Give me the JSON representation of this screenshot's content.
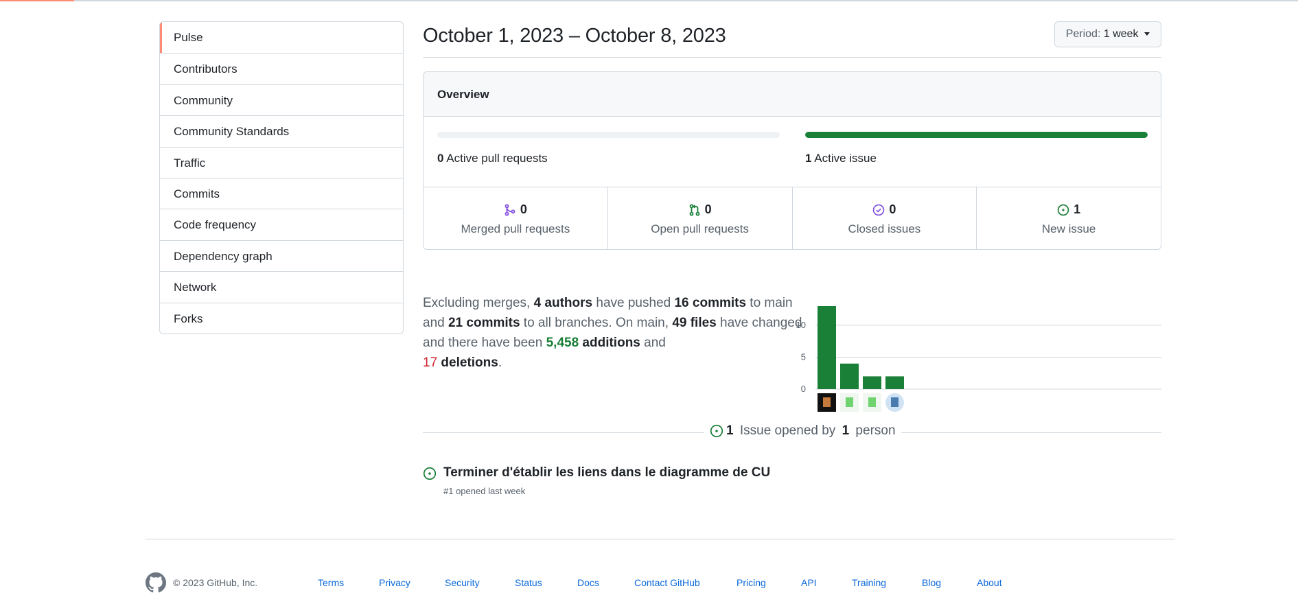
{
  "sidebar": {
    "items": [
      {
        "label": "Pulse",
        "selected": true
      },
      {
        "label": "Contributors"
      },
      {
        "label": "Community"
      },
      {
        "label": "Community Standards"
      },
      {
        "label": "Traffic"
      },
      {
        "label": "Commits"
      },
      {
        "label": "Code frequency"
      },
      {
        "label": "Dependency graph"
      },
      {
        "label": "Network"
      },
      {
        "label": "Forks"
      }
    ]
  },
  "header": {
    "date_range": "October 1, 2023 – October 8, 2023",
    "period_prefix": "Period:",
    "period_value": "1 week"
  },
  "overview": {
    "title": "Overview",
    "active_pull_requests": {
      "count": "0",
      "label": "Active pull requests",
      "fill_fraction": 0
    },
    "active_issues": {
      "count": "1",
      "label": "Active issue",
      "fill_fraction": 1
    },
    "stats": [
      {
        "count": "0",
        "label": "Merged pull requests",
        "icon": "git-merge-icon",
        "color": "#8250df"
      },
      {
        "count": "0",
        "label": "Open pull requests",
        "icon": "git-pull-request-icon",
        "color": "#1a7f37"
      },
      {
        "count": "0",
        "label": "Closed issues",
        "icon": "issue-closed-icon",
        "color": "#8250df"
      },
      {
        "count": "1",
        "label": "New issue",
        "icon": "issue-opened-icon",
        "color": "#1a7f37"
      }
    ]
  },
  "summary": {
    "t1": "Excluding merges, ",
    "authors": "4 authors",
    "t2": " have pushed ",
    "commits_main": "16 commits",
    "t3": " to main and ",
    "commits_all": "21 commits",
    "t4": " to all branches. On main, ",
    "files": "49 files",
    "t5": " have changed and there have been ",
    "additions_num": "5,458",
    "additions_word": " additions",
    "t6": " and ",
    "deletions_num": "17",
    "deletions_word": " deletions",
    "t7": "."
  },
  "chart_data": {
    "type": "bar",
    "categories": [
      "author-1",
      "author-2",
      "author-3",
      "author-4"
    ],
    "values": [
      13,
      4,
      2,
      2
    ],
    "yticks": [
      "0",
      "5",
      "10"
    ],
    "ylim": [
      0,
      13
    ],
    "grid": true,
    "color": "#1a7f37"
  },
  "issues": {
    "count": "1",
    "mid": " Issue opened by ",
    "people": "1",
    "tail": " person",
    "items": [
      {
        "title": "Terminer d'établir les liens dans le diagramme de CU",
        "meta": "#1 opened last week"
      }
    ]
  },
  "footer": {
    "copyright": "© 2023 GitHub, Inc.",
    "links": [
      "Terms",
      "Privacy",
      "Security",
      "Status",
      "Docs",
      "Contact GitHub",
      "Pricing",
      "API",
      "Training",
      "Blog",
      "About"
    ]
  },
  "colors": {
    "accent_orange": "#fd8c73",
    "green": "#1a7f37",
    "purple": "#8250df",
    "red": "#cf222e",
    "link": "#0969da"
  }
}
